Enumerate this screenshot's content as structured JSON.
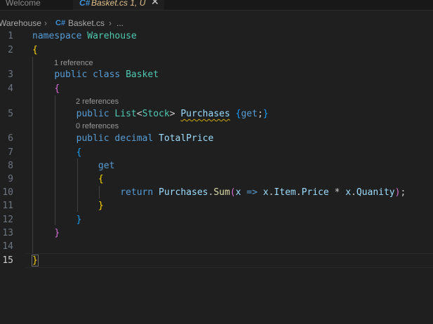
{
  "tabs": [
    {
      "label": "Welcome",
      "active": false
    },
    {
      "label": "Basket.cs 1, U",
      "active": true
    }
  ],
  "tab_close_glyph": "✕",
  "breadcrumb": {
    "items": [
      "Warehouse",
      "Basket.cs",
      "..."
    ],
    "separator": "›",
    "file_icon": "C#"
  },
  "editor": {
    "line_numbers": [
      "1",
      "2",
      "3",
      "4",
      "5",
      "6",
      "7",
      "8",
      "9",
      "10",
      "11",
      "12",
      "13",
      "14",
      "15"
    ],
    "active_line": "15",
    "codelens": {
      "class_refs": "1 reference",
      "purchases_refs": "2 references",
      "totalprice_refs": "0 references"
    },
    "tokens": {
      "namespace_kw": "namespace",
      "namespace_name": "Warehouse",
      "public": "public",
      "class_kw": "class",
      "class_name": "Basket",
      "list_type": "List",
      "stock_type": "Stock",
      "purchases": "Purchases",
      "get": "get",
      "decimal": "decimal",
      "total_price": "TotalPrice",
      "return": "return",
      "sum": "Sum",
      "param": "x",
      "arrow": "=>",
      "item": "Item",
      "price": "Price",
      "quanity": "Quanity",
      "star": "*"
    }
  },
  "colors": {
    "background": "#1f1f1f",
    "keyword": "#569cd6",
    "type": "#4ec9b0",
    "property": "#9cdcfe",
    "function": "#dcdcaa",
    "bracket_level1": "#ffd700",
    "bracket_level2": "#da70d6",
    "bracket_level3": "#179fff",
    "warning_squiggle": "#cca700",
    "modified_tab": "#e2c08d"
  }
}
